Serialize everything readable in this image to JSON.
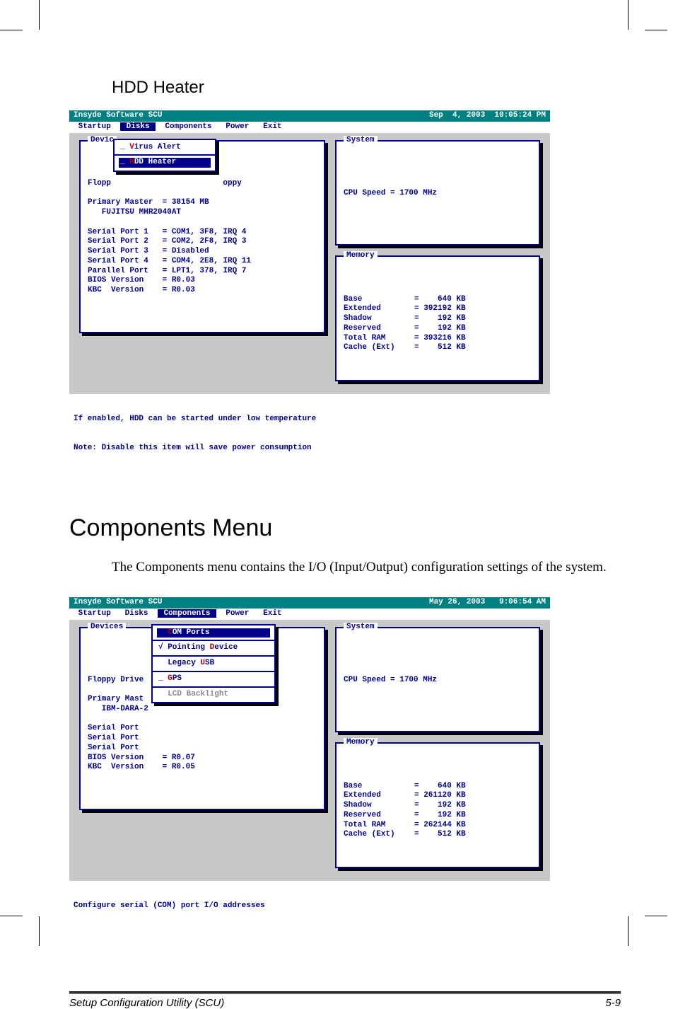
{
  "headings": {
    "hdd_heater": "HDD Heater",
    "components_menu": "Components Menu"
  },
  "paragraphs": {
    "components_intro": "The Components menu contains the I/O (Input/Output) configuration settings of the system."
  },
  "bios1": {
    "title_left": "Insyde Software SCU",
    "title_right": "Sep  4, 2003  10:05:24 PM",
    "menubar": {
      "items": [
        "Startup",
        "Disks",
        "Components",
        "Power",
        "Exit"
      ],
      "selected_index": 1
    },
    "devices_panel_title": "Devic",
    "popup": {
      "items": [
        {
          "prefix": "_ ",
          "hot": "V",
          "rest": "irus Alert",
          "selected": false
        },
        {
          "prefix": "_ ",
          "hot": "H",
          "rest": "DD Heater",
          "selected": true
        }
      ]
    },
    "devices_lines": [
      "Flopp                        oppy",
      "",
      "Primary Master  = 38154 MB",
      "   FUJITSU MHR2040AT",
      "",
      "Serial Port 1   = COM1, 3F8, IRQ 4",
      "Serial Port 2   = COM2, 2F8, IRQ 3",
      "Serial Port 3   = Disabled",
      "Serial Port 4   = COM4, 2E8, IRQ 11",
      "Parallel Port   = LPT1, 378, IRQ 7",
      "BIOS Version    = R0.03",
      "KBC  Version    = R0.03"
    ],
    "system_panel_title": "System",
    "system_lines": [
      "",
      "CPU Speed = 1700 MHz",
      "",
      ""
    ],
    "memory_panel_title": "Memory",
    "memory_rows": [
      {
        "label": "Base",
        "value": "=    640 KB"
      },
      {
        "label": "Extended",
        "value": "= 392192 KB"
      },
      {
        "label": "Shadow",
        "value": "=    192 KB"
      },
      {
        "label": "Reserved",
        "value": "=    192 KB"
      },
      {
        "label": "Total RAM",
        "value": "= 393216 KB"
      },
      {
        "label": "Cache (Ext)",
        "value": "=    512 KB"
      }
    ],
    "status_line1": "If enabled, HDD can be started under low temperature",
    "status_line2": "Note: Disable this item will save power consumption"
  },
  "bios2": {
    "title_left": "Insyde Software SCU",
    "title_right": "May 26, 2003   9:06:54 AM",
    "menubar": {
      "items": [
        "Startup",
        "Disks",
        "Components",
        "Power",
        "Exit"
      ],
      "selected_index": 2
    },
    "devices_panel_title": "Devices",
    "devices_lines_left": [
      "",
      "Floppy Drive",
      "",
      "Primary Mast",
      "   IBM-DARA-2",
      "",
      "Serial Port",
      "Serial Port",
      "Serial Port",
      "BIOS Version    = R0.07",
      "KBC  Version    = R0.05"
    ],
    "popup": {
      "items": [
        {
          "prefix": "  ",
          "hot": "C",
          "rest": "OM Ports",
          "selected": true,
          "disabled": false
        },
        {
          "prefix": "√ ",
          "hot": "",
          "rest_pre": "Pointing ",
          "hot2": "D",
          "rest2": "evice",
          "selected": false,
          "disabled": false
        },
        {
          "prefix": "  ",
          "hot": "",
          "rest_pre": "Legacy ",
          "hot2": "U",
          "rest2": "SB",
          "selected": false,
          "disabled": false
        },
        {
          "prefix": "_ ",
          "hot": "G",
          "rest": "PS",
          "selected": false,
          "disabled": false
        },
        {
          "prefix": "  ",
          "hot": "",
          "rest": "LCD Backlight",
          "selected": false,
          "disabled": true
        }
      ]
    },
    "system_panel_title": "System",
    "system_lines": [
      "",
      "CPU Speed = 1700 MHz",
      "",
      ""
    ],
    "memory_panel_title": "Memory",
    "memory_rows": [
      {
        "label": "Base",
        "value": "=    640 KB"
      },
      {
        "label": "Extended",
        "value": "= 261120 KB"
      },
      {
        "label": "Shadow",
        "value": "=    192 KB"
      },
      {
        "label": "Reserved",
        "value": "=    192 KB"
      },
      {
        "label": "Total RAM",
        "value": "= 262144 KB"
      },
      {
        "label": "Cache (Ext)",
        "value": "=    512 KB"
      }
    ],
    "status_line1": "Configure serial (COM) port I/O addresses",
    "status_line2": ""
  },
  "footer": {
    "left": "Setup Configuration Utility (SCU)",
    "right": "5-9"
  }
}
